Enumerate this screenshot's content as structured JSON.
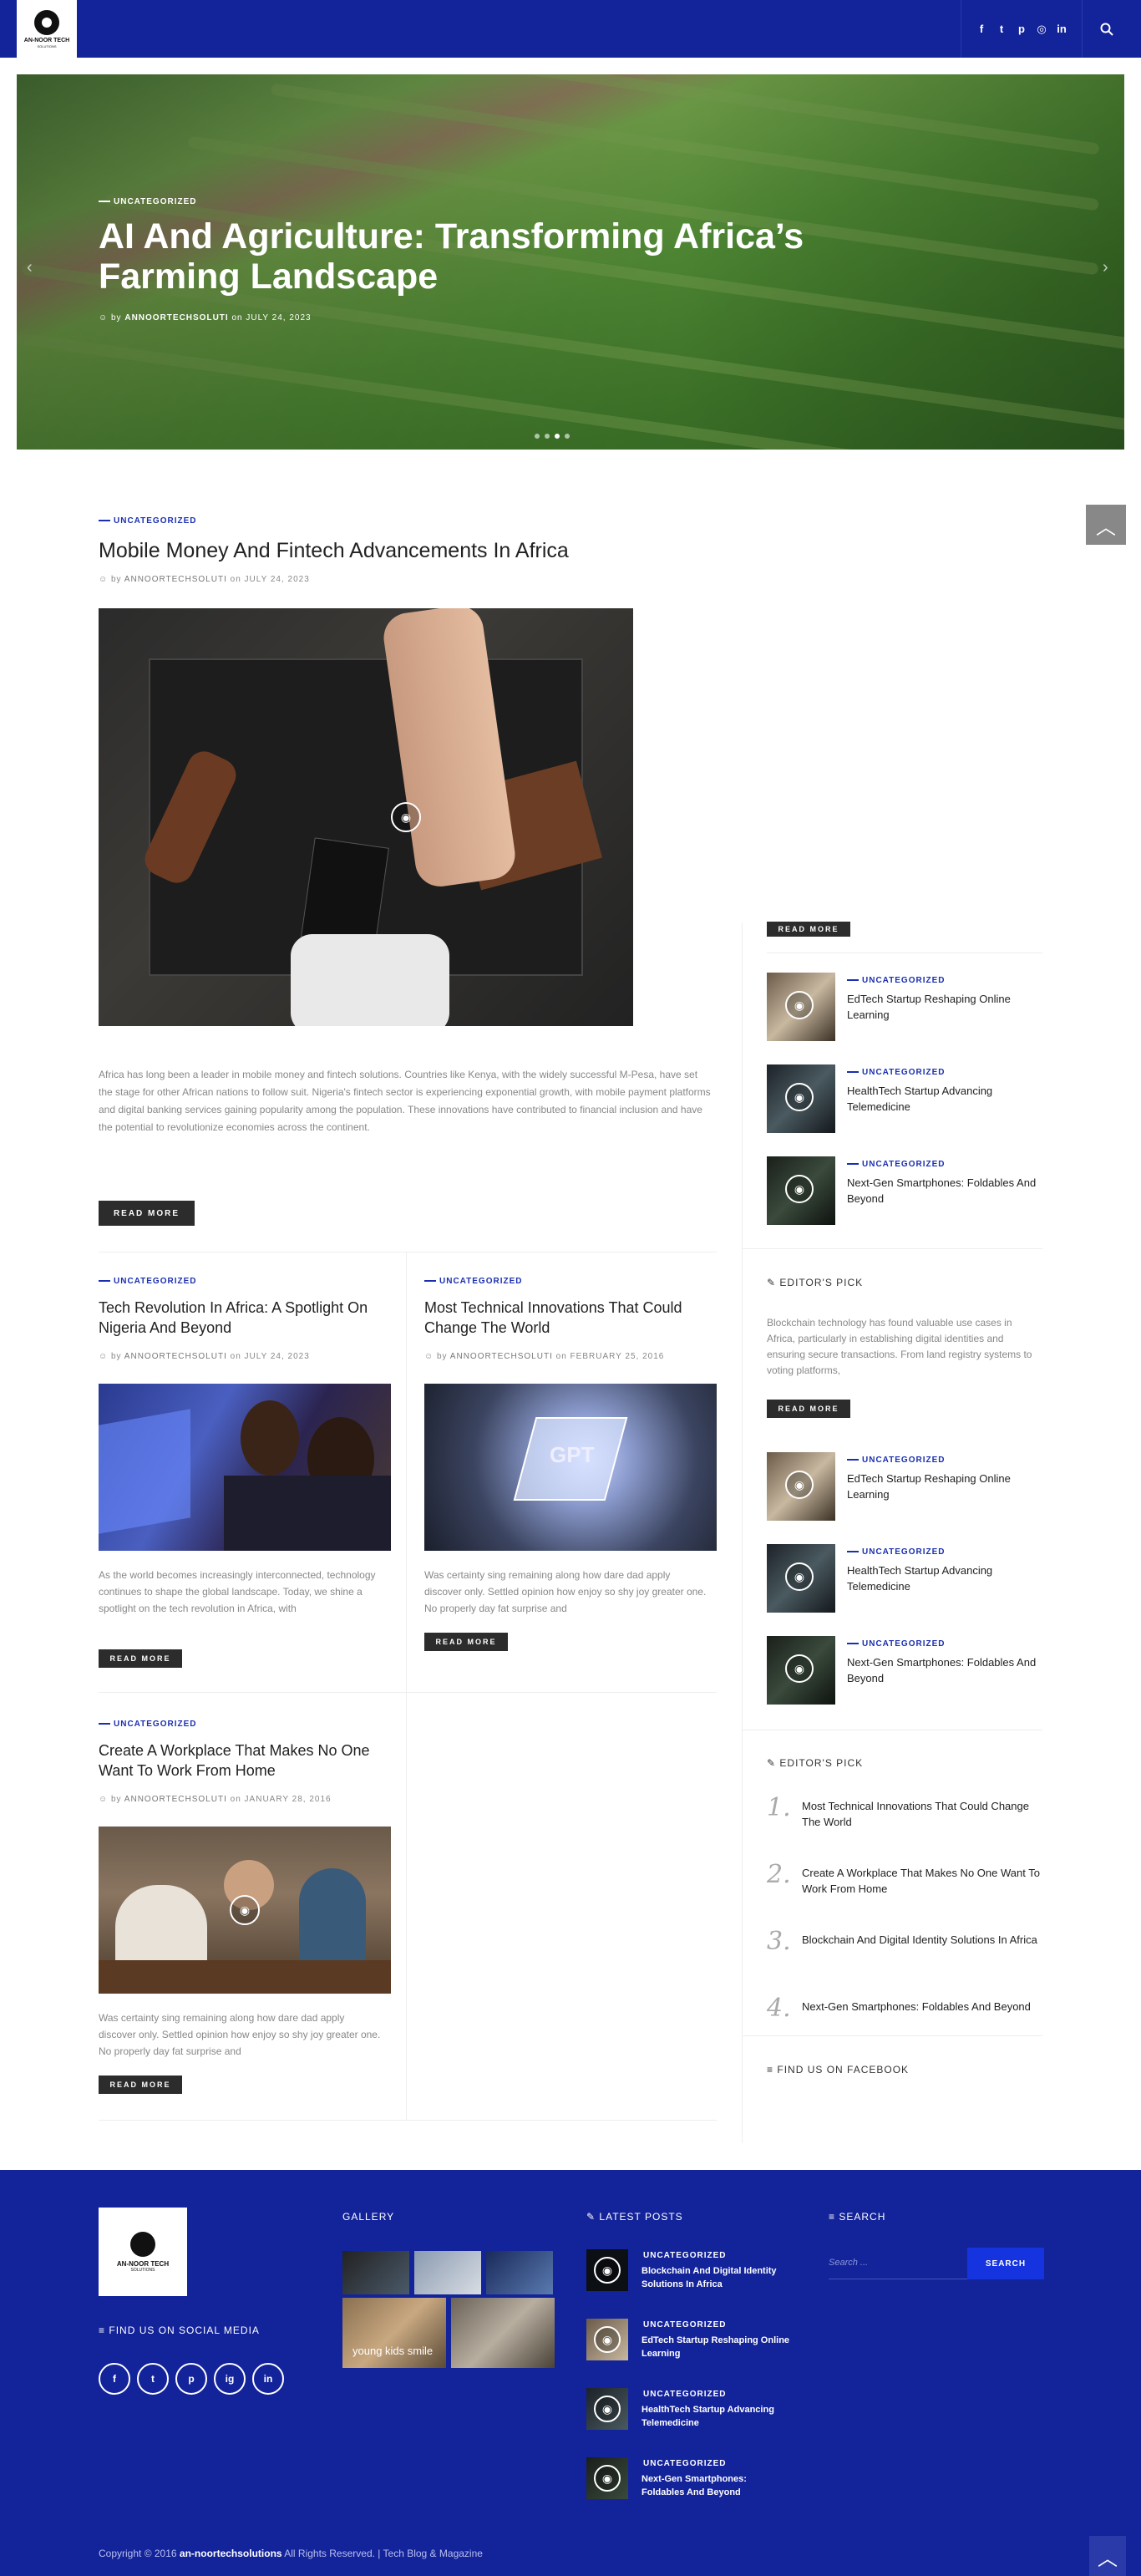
{
  "header": {
    "logo_title": "AN-NOOR TECH",
    "logo_sub": "SOLUTIONS",
    "social_icons": [
      "facebook-icon",
      "twitter-icon",
      "pinterest-icon",
      "instagram-icon",
      "linkedin-icon"
    ],
    "search_icon": "search-icon"
  },
  "hero": {
    "category": "UNCATEGORIZED",
    "title": "AI And Agriculture: Transforming Africa’s Farming Landscape",
    "by": "by",
    "author": "ANNOORTECHSOLUTI",
    "on": "on",
    "date": "JULY 24, 2023"
  },
  "featured": {
    "category": "UNCATEGORIZED",
    "title": "Mobile Money And Fintech Advancements In Africa",
    "by": "by",
    "author": "ANNOORTECHSOLUTI",
    "on": "on",
    "date": "JULY 24, 2023",
    "excerpt": "Africa has long been a leader in mobile money and fintech solutions. Countries like Kenya, with the widely successful M-Pesa, have set the stage for other African nations to follow suit. Nigeria's fintech sector is experiencing exponential growth, with mobile payment platforms and digital banking services gaining popularity among the population. These innovations have contributed to financial inclusion and have the potential to revolutionize economies across the continent.",
    "read_more": "READ MORE"
  },
  "cards": [
    {
      "category": "UNCATEGORIZED",
      "title": "Tech Revolution In Africa: A Spotlight On Nigeria And Beyond",
      "by": "by",
      "author": "ANNOORTECHSOLUTI",
      "on": "on",
      "date": "JULY 24, 2023",
      "excerpt": "As the world becomes increasingly interconnected, technology continues to shape the global landscape. Today, we shine a spotlight on the tech revolution in Africa, with",
      "read_more": "READ MORE"
    },
    {
      "category": "UNCATEGORIZED",
      "title": "Most Technical Innovations That Could Change The World",
      "by": "by",
      "author": "ANNOORTECHSOLUTI",
      "on": "on",
      "date": "FEBRUARY 25, 2016",
      "excerpt": "Was certainty sing remaining along how dare dad apply discover only. Settled opinion how enjoy so shy joy greater one. No properly day fat surprise and",
      "read_more": "READ MORE"
    },
    {
      "category": "UNCATEGORIZED",
      "title": "Create A Workplace That Makes No One Want To Work From Home",
      "by": "by",
      "author": "ANNOORTECHSOLUTI",
      "on": "on",
      "date": "JANUARY 28, 2016",
      "excerpt": "Was certainty sing remaining along how dare dad apply discover only. Settled opinion how enjoy so shy joy greater one. No properly day fat surprise and",
      "read_more": "READ MORE"
    }
  ],
  "sidebar": {
    "top_read_more": "READ MORE",
    "list1": [
      {
        "category": "UNCATEGORIZED",
        "title": "EdTech Startup Reshaping Online Learning"
      },
      {
        "category": "UNCATEGORIZED",
        "title": "HealthTech Startup Advancing Telemedicine"
      },
      {
        "category": "UNCATEGORIZED",
        "title": "Next-Gen Smartphones: Foldables And Beyond"
      }
    ],
    "editors_pick_1": "EDITOR'S PICK",
    "pick_excerpt": "Blockchain technology has found valuable use cases in Africa, particularly in establishing digital identities and ensuring secure transactions. From land registry systems to voting platforms,",
    "pick_read_more": "READ MORE",
    "list2": [
      {
        "category": "UNCATEGORIZED",
        "title": "EdTech Startup Reshaping Online Learning"
      },
      {
        "category": "UNCATEGORIZED",
        "title": "HealthTech Startup Advancing Telemedicine"
      },
      {
        "category": "UNCATEGORIZED",
        "title": "Next-Gen Smartphones: Foldables And Beyond"
      }
    ],
    "editors_pick_2": "EDITOR'S PICK",
    "numbered": [
      {
        "num": "1.",
        "title": "Most Technical Innovations That Could Change The World"
      },
      {
        "num": "2.",
        "title": "Create A Workplace That Makes No One Want To Work From Home"
      },
      {
        "num": "3.",
        "title": "Blockchain And Digital Identity Solutions In Africa"
      },
      {
        "num": "4.",
        "title": "Next-Gen Smartphones: Foldables And Beyond"
      }
    ],
    "facebook": "FIND US ON FACEBOOK"
  },
  "footer": {
    "logo_title": "AN-NOOR TECH",
    "logo_sub": "SOLUTIONS",
    "social_head": "FIND US ON SOCIAL MEDIA",
    "social": [
      "f",
      "t",
      "p",
      "ig",
      "in"
    ],
    "gallery_head": "GALLERY",
    "gallery_caption": "young kids smile",
    "latest_head": "LATEST POSTS",
    "latest": [
      {
        "category": "UNCATEGORIZED",
        "title": "Blockchain And Digital Identity Solutions In Africa"
      },
      {
        "category": "UNCATEGORIZED",
        "title": "EdTech Startup Reshaping Online Learning"
      },
      {
        "category": "UNCATEGORIZED",
        "title": "HealthTech Startup Advancing Telemedicine"
      },
      {
        "category": "UNCATEGORIZED",
        "title": "Next-Gen Smartphones: Foldables And Beyond"
      }
    ],
    "search_head": "SEARCH",
    "search_placeholder": "Search ...",
    "search_button": "SEARCH",
    "copyright_pre": "Copyright © 2016",
    "copyright_site": "an-noortechsolutions",
    "copyright_post": "All Rights Reserved. | Tech Blog & Magazine"
  }
}
